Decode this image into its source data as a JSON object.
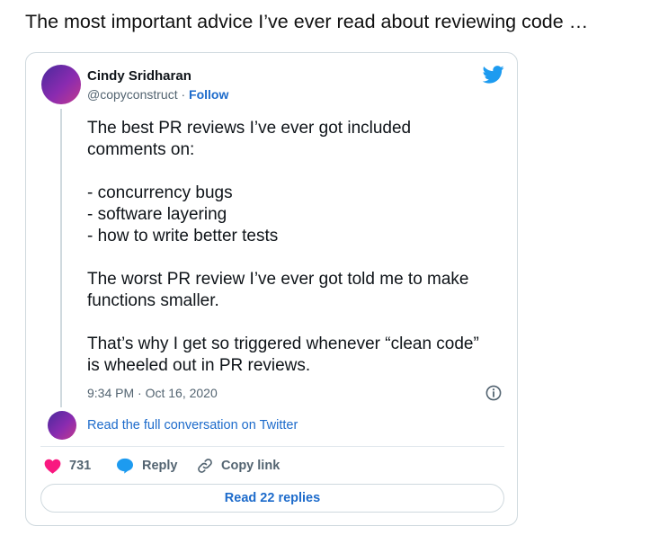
{
  "page": {
    "title": "The most important advice I’ve ever read about reviewing code …"
  },
  "tweet": {
    "author_name": "Cindy Sridharan",
    "handle": "@copyconstruct",
    "separator": " · ",
    "follow_label": "Follow",
    "text": "The best PR reviews I’ve ever got included\ncomments on:\n\n- concurrency bugs\n- software layering\n- how to write better tests\n\nThe worst PR review I’ve ever got told me to make\nfunctions smaller.\n\nThat’s why I get so triggered whenever “clean code”\nis wheeled out in PR reviews.",
    "timestamp": "9:34 PM · Oct 16, 2020",
    "read_conversation_label": "Read the full conversation on Twitter",
    "likes_count": "731",
    "reply_label": "Reply",
    "copy_link_label": "Copy link",
    "read_replies_label": "Read 22 replies"
  },
  "icons": {
    "brand": "twitter-bird-icon",
    "info": "info-icon",
    "like": "heart-icon",
    "reply": "speech-bubble-icon",
    "copy": "link-icon"
  },
  "colors": {
    "link": "#1d6bcb",
    "twitter_blue": "#1d9bf0",
    "heart": "#f91880",
    "muted": "#536471",
    "border": "#cfd9de"
  }
}
